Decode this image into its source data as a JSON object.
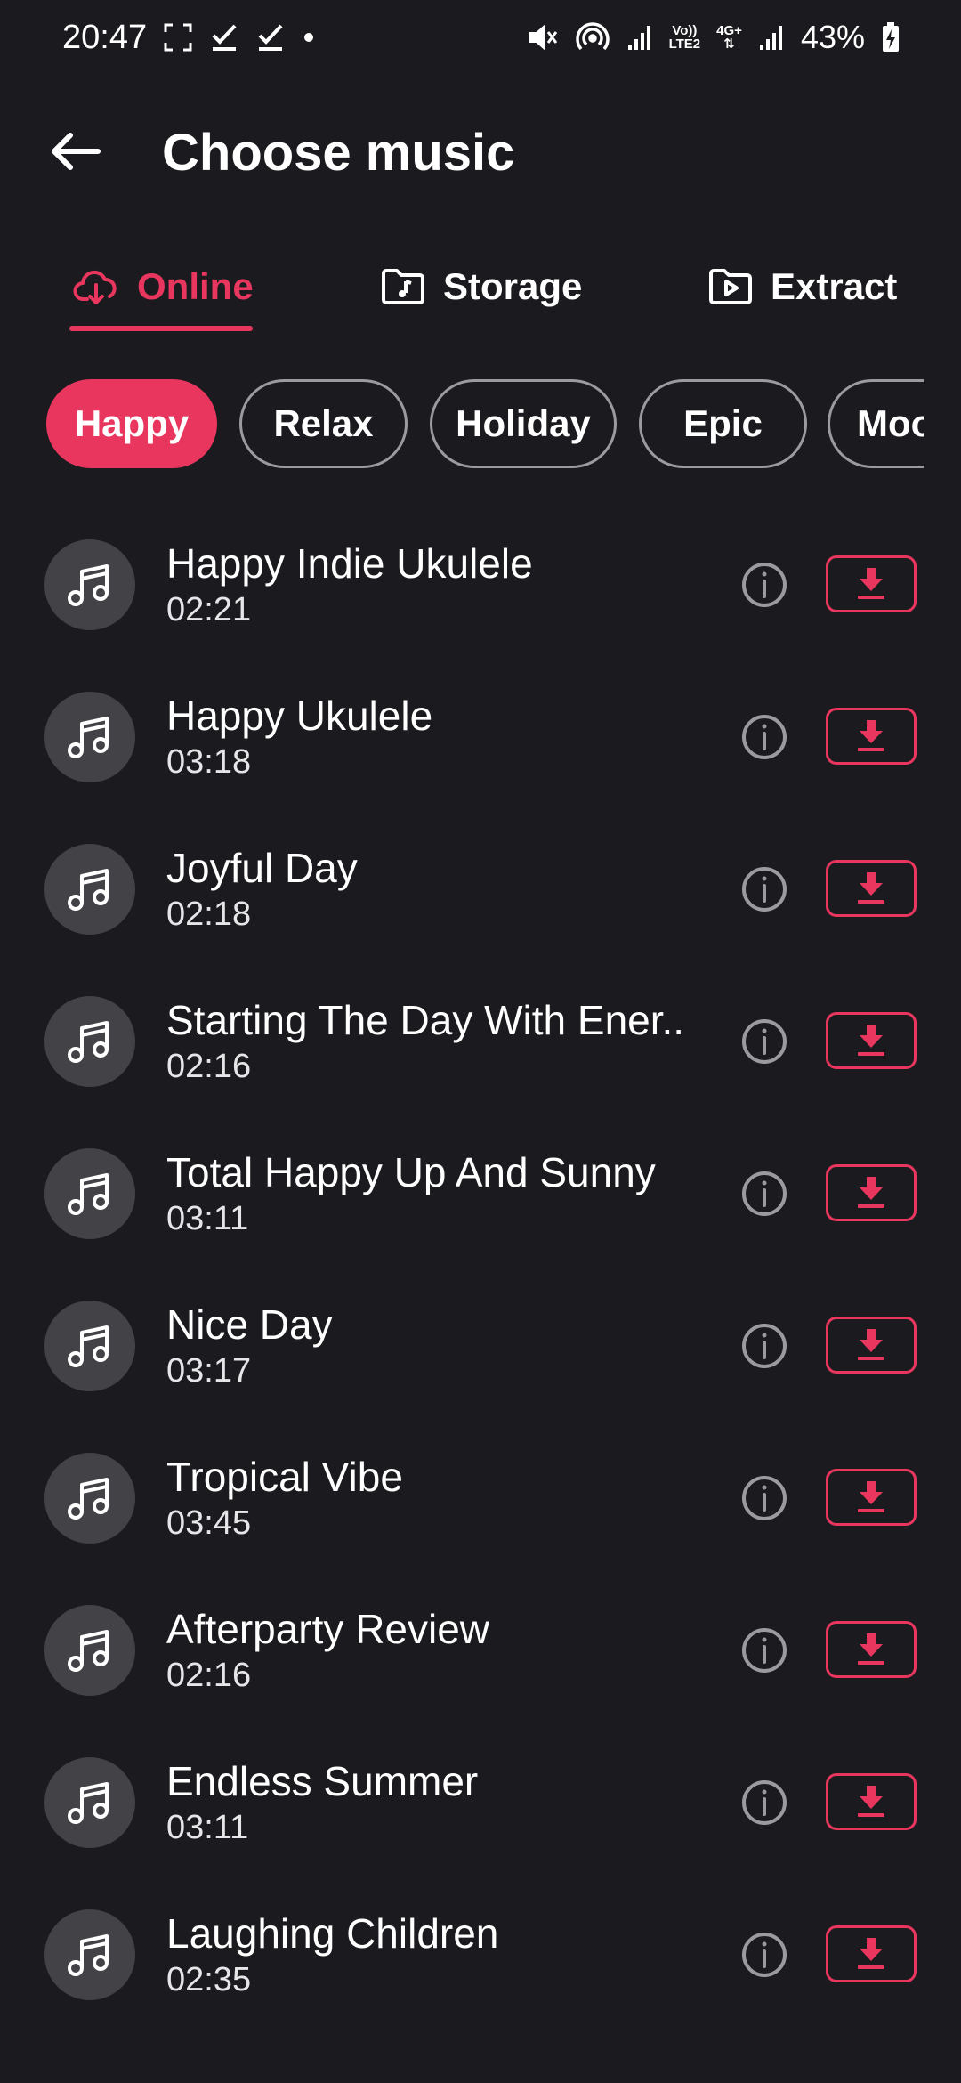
{
  "status_bar": {
    "time": "20:47",
    "network_label_top": "Vo))",
    "network_label_bottom": "LTE2",
    "network_type": "4G+",
    "battery": "43%",
    "icons": [
      "screenshot-icon",
      "check-icon",
      "check-icon",
      "dot-icon",
      "mute-icon",
      "hotspot-icon",
      "signal-icon",
      "signal-icon",
      "battery-charging-icon"
    ]
  },
  "header": {
    "title": "Choose music",
    "back_icon": "arrow-left-icon"
  },
  "tabs": [
    {
      "label": "Online",
      "icon": "cloud-download-icon",
      "active": true
    },
    {
      "label": "Storage",
      "icon": "music-folder-icon",
      "active": false
    },
    {
      "label": "Extract",
      "icon": "video-folder-icon",
      "active": false
    }
  ],
  "chips": [
    {
      "label": "Happy",
      "active": true
    },
    {
      "label": "Relax",
      "active": false
    },
    {
      "label": "Holiday",
      "active": false
    },
    {
      "label": "Epic",
      "active": false
    },
    {
      "label": "Mood",
      "active": false
    }
  ],
  "tracks": [
    {
      "title": "Happy Indie Ukulele",
      "duration": "02:21"
    },
    {
      "title": "Happy Ukulele",
      "duration": "03:18"
    },
    {
      "title": "Joyful Day",
      "duration": "02:18"
    },
    {
      "title": "Starting The Day With Ener..",
      "duration": "02:16"
    },
    {
      "title": "Total Happy Up And Sunny",
      "duration": "03:11"
    },
    {
      "title": "Nice Day",
      "duration": "03:17"
    },
    {
      "title": "Tropical Vibe",
      "duration": "03:45"
    },
    {
      "title": "Afterparty Review",
      "duration": "02:16"
    },
    {
      "title": "Endless Summer",
      "duration": "03:11"
    },
    {
      "title": "Laughing Children",
      "duration": "02:35"
    }
  ],
  "colors": {
    "background": "#1b1b1f",
    "accent": "#e8365f",
    "avatar": "#434246",
    "chip_border": "#9b9b9f"
  }
}
